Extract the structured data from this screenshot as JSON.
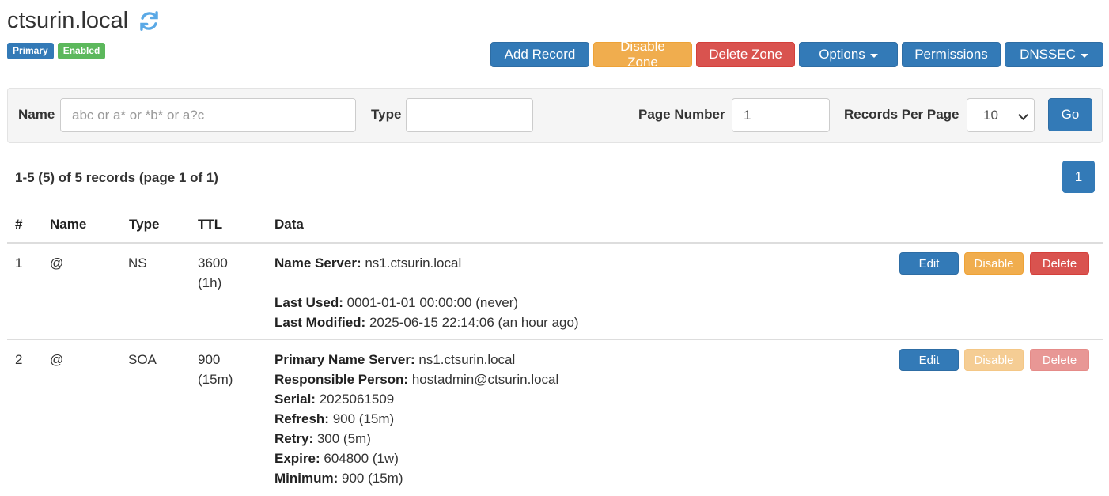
{
  "zone": {
    "name": "ctsurin.local",
    "badges": [
      "Primary",
      "Enabled"
    ]
  },
  "toolbar": {
    "add_record": "Add Record",
    "disable_zone": "Disable Zone",
    "delete_zone": "Delete Zone",
    "options": "Options",
    "permissions": "Permissions",
    "dnssec": "DNSSEC"
  },
  "filter": {
    "name_label": "Name",
    "name_placeholder": "abc or a* or *b* or a?c",
    "name_value": "",
    "type_label": "Type",
    "type_value": "",
    "page_number_label": "Page Number",
    "page_number_value": "1",
    "records_per_page_label": "Records Per Page",
    "records_per_page_value": "10",
    "go_label": "Go"
  },
  "summary": "1-5 (5) of 5 records (page 1 of 1)",
  "pagination": {
    "current": "1"
  },
  "table": {
    "headers": [
      "#",
      "Name",
      "Type",
      "TTL",
      "Data"
    ],
    "rows": [
      {
        "num": "1",
        "name": "@",
        "type": "NS",
        "ttl": "3600",
        "ttl_human": "(1h)",
        "data": [
          {
            "k": "Name Server:",
            "v": " ns1.ctsurin.local"
          },
          {
            "k": "",
            "v": ""
          },
          {
            "k": "Last Used:",
            "v": " 0001-01-01 00:00:00 (never)"
          },
          {
            "k": "Last Modified:",
            "v": " 2025-06-15 22:14:06 (an hour ago)"
          }
        ],
        "actions": {
          "edit": "Edit",
          "disable": "Disable",
          "delete": "Delete"
        }
      },
      {
        "num": "2",
        "name": "@",
        "type": "SOA",
        "ttl": "900",
        "ttl_human": "(15m)",
        "data": [
          {
            "k": "Primary Name Server:",
            "v": " ns1.ctsurin.local"
          },
          {
            "k": "Responsible Person:",
            "v": " hostadmin@ctsurin.local"
          },
          {
            "k": "Serial:",
            "v": " 2025061509"
          },
          {
            "k": "Refresh:",
            "v": " 900 (15m)"
          },
          {
            "k": "Retry:",
            "v": " 300 (5m)"
          },
          {
            "k": "Expire:",
            "v": " 604800 (1w)"
          },
          {
            "k": "Minimum:",
            "v": " 900 (15m)"
          }
        ],
        "actions": {
          "edit": "Edit",
          "disable": "Disable",
          "delete": "Delete"
        }
      }
    ]
  },
  "colors": {
    "primary": "#337ab7",
    "success": "#5cb85c",
    "warning": "#f0ad4e",
    "danger": "#d9534f",
    "refresh_icon": "#5aa9e6"
  }
}
